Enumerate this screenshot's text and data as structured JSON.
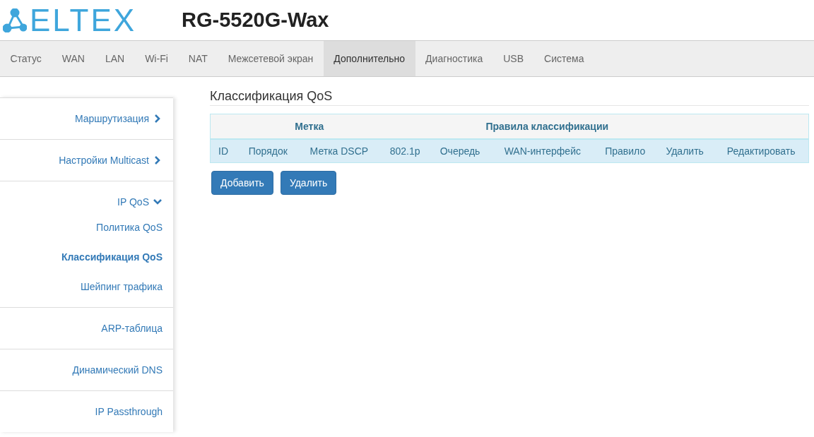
{
  "logo": {
    "text": "ELTEX"
  },
  "device": {
    "title": "RG-5520G-Wax"
  },
  "tabs": [
    {
      "label": "Статус",
      "selected": false
    },
    {
      "label": "WAN",
      "selected": false
    },
    {
      "label": "LAN",
      "selected": false
    },
    {
      "label": "Wi-Fi",
      "selected": false
    },
    {
      "label": "NAT",
      "selected": false
    },
    {
      "label": "Межсетевой экран",
      "selected": false
    },
    {
      "label": "Дополнительно",
      "selected": true
    },
    {
      "label": "Диагностика",
      "selected": false
    },
    {
      "label": "USB",
      "selected": false
    },
    {
      "label": "Система",
      "selected": false
    }
  ],
  "sidebar": {
    "items": [
      {
        "label": "Маршрутизация",
        "kind": "collapsed"
      },
      {
        "label": "Настройки Multicast",
        "kind": "collapsed"
      },
      {
        "label": "IP QoS",
        "kind": "expanded",
        "children": [
          {
            "label": "Политика QoS",
            "selected": false
          },
          {
            "label": "Классификация QoS",
            "selected": true
          },
          {
            "label": "Шейпинг трафика",
            "selected": false
          }
        ]
      },
      {
        "label": "ARP-таблица",
        "kind": "link"
      },
      {
        "label": "Динамический DNS",
        "kind": "link"
      },
      {
        "label": "IP Passthrough",
        "kind": "link"
      }
    ]
  },
  "content": {
    "title": "Классификация QoS",
    "table": {
      "column_groups": [
        {
          "columns": [
            "ID"
          ]
        },
        {
          "label": "Метка",
          "columns": [
            "Порядок",
            "Метка DSCP"
          ]
        },
        {
          "label": "Правила классификации",
          "columns": [
            "802.1p",
            "Очередь",
            "WAN-интерфейс",
            "Правило",
            "Удалить"
          ]
        },
        {
          "columns": [
            "Редактировать"
          ]
        }
      ]
    },
    "buttons": [
      "Добавить",
      "Удалить"
    ]
  }
}
